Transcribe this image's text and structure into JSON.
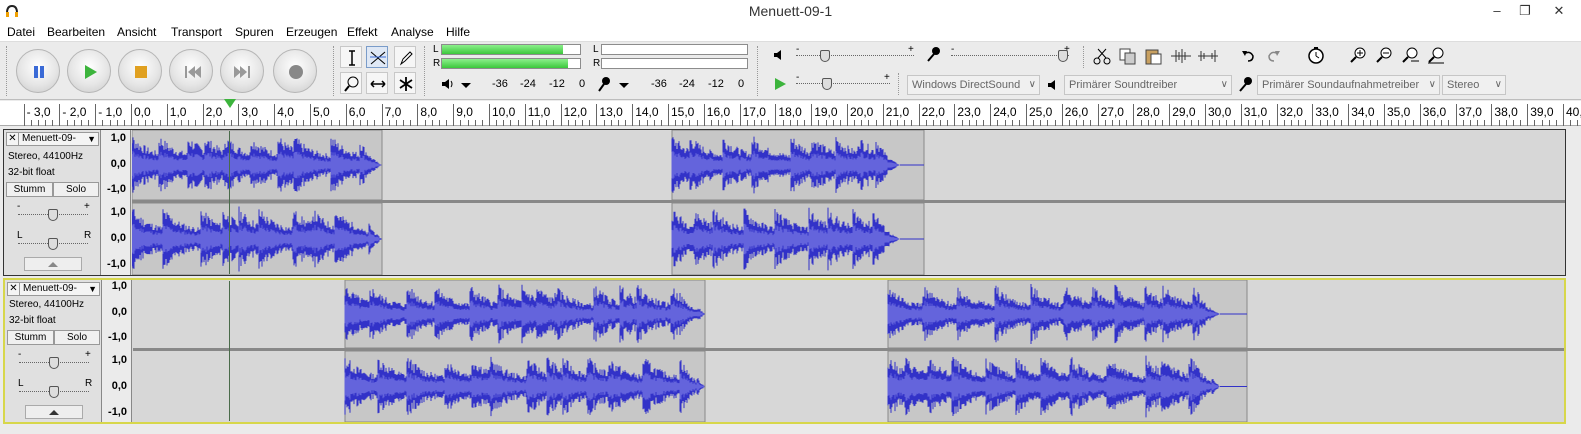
{
  "window": {
    "title": "Menuett-09-1",
    "min": "–",
    "max": "❐",
    "close": "✕"
  },
  "menu": [
    "Datei",
    "Bearbeiten",
    "Ansicht",
    "Transport",
    "Spuren",
    "Erzeugen",
    "Effekt",
    "Analyse",
    "Hilfe"
  ],
  "meter": {
    "left_label": "L",
    "right_label": "R",
    "play_left_level": 0.88,
    "play_right_level": 0.91,
    "scale": [
      "-36",
      "-24",
      "-12",
      "0"
    ],
    "rec_scale": [
      "-36",
      "-24",
      "-12",
      "0"
    ]
  },
  "mixer": {
    "plus": "+",
    "minus": "-"
  },
  "device": {
    "host": "Windows DirectSound",
    "playback": "Primärer Soundtreiber",
    "recording": "Primärer Soundaufnahmetreiber",
    "channels": "Stereo"
  },
  "ruler": [
    "- 3,0",
    "- 2,0",
    "- 1,0",
    "0,0",
    "1,0",
    "2,0",
    "3,0",
    "4,0",
    "5,0",
    "6,0",
    "7,0",
    "8,0",
    "9,0",
    "10,0",
    "11,0",
    "12,0",
    "13,0",
    "14,0",
    "15,0",
    "16,0",
    "17,0",
    "18,0",
    "19,0",
    "20,0",
    "21,0",
    "22,0",
    "23,0",
    "24,0",
    "25,0",
    "26,0",
    "27,0",
    "28,0",
    "29,0",
    "30,0",
    "31,0",
    "32,0",
    "33,0",
    "34,0",
    "35,0",
    "36,0",
    "37,0",
    "38,0",
    "39,0",
    "40,"
  ],
  "tracks": [
    {
      "name": "Menuett-09-",
      "format": "Stereo, 44100Hz",
      "bits": "32-bit float",
      "mute": "Stumm",
      "solo": "Solo",
      "scale": [
        "1,0",
        "0,0",
        "-1,0",
        "1,0",
        "0,0",
        "-1,0"
      ],
      "gain_minus": "-",
      "gain_plus": "+",
      "pan_left": "L",
      "pan_right": "R"
    },
    {
      "name": "Menuett-09-",
      "format": "Stereo, 44100Hz",
      "bits": "32-bit float",
      "mute": "Stumm",
      "solo": "Solo",
      "scale": [
        "1,0",
        "0,0",
        "-1,0",
        "1,0",
        "0,0",
        "-1,0"
      ],
      "gain_minus": "-",
      "gain_plus": "+",
      "pan_left": "L",
      "pan_right": "R"
    }
  ],
  "colors": {
    "wave": "#3232c8",
    "wave_rms": "#6464dc",
    "selected_track_border": "#d7d74b",
    "meter_green": "#3cc83c"
  }
}
